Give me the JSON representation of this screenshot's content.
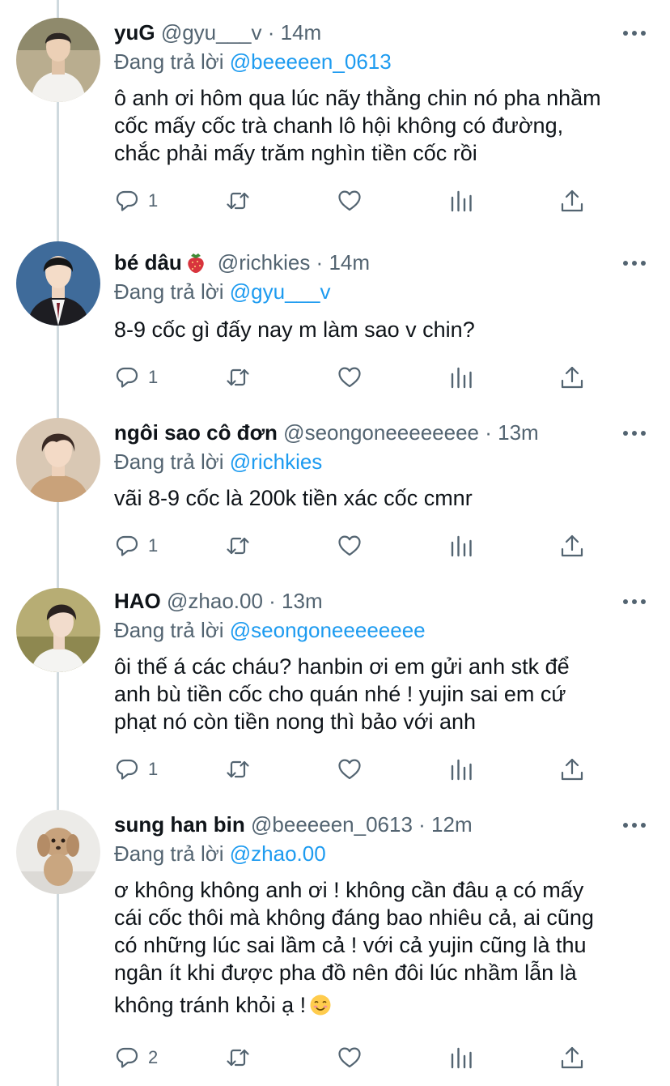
{
  "tweets": [
    {
      "name": "yuG",
      "handle": "@gyu___v",
      "time": "14m",
      "replying_prefix": "Đang trả lời ",
      "replying_to": "@beeeeen_0613",
      "text_lines": [
        "ô anh ơi hôm qua lúc nãy thằng chin nó pha nhầm",
        "cốc mấy cốc trà chanh lô hội không có đường,",
        "chắc phải mấy trăm nghìn tiền cốc rồi"
      ],
      "reply_count": "1"
    },
    {
      "name": "bé dâu",
      "name_emoji": "strawberry-emoji",
      "handle": "@richkies",
      "time": "14m",
      "replying_prefix": "Đang trả lời ",
      "replying_to": "@gyu___v",
      "text_lines": [
        "8-9 cốc gì đấy nay m làm sao v chin?"
      ],
      "reply_count": "1"
    },
    {
      "name": "ngôi sao cô đơn",
      "handle": "@seongoneeeeeeee",
      "time": "13m",
      "replying_prefix": "Đang trả lời ",
      "replying_to": "@richkies",
      "text_lines": [
        "vãi 8-9 cốc là 200k tiền xác cốc cmnr"
      ],
      "reply_count": "1"
    },
    {
      "name": "HAO",
      "handle": "@zhao.00",
      "time": "13m",
      "replying_prefix": "Đang trả lời ",
      "replying_to": "@seongoneeeeeeee",
      "text_lines": [
        "ôi thế á các cháu? hanbin ơi em gửi anh stk để",
        "anh bù tiền cốc cho quán nhé ! yujin sai em cứ",
        "phạt nó còn tiền nong thì bảo với anh"
      ],
      "reply_count": "1"
    },
    {
      "name": "sung han bin",
      "handle": "@beeeeen_0613",
      "time": "12m",
      "replying_prefix": "Đang trả lời ",
      "replying_to": "@zhao.00",
      "text_lines": [
        "ơ không không anh ơi ! không cần đâu ạ có mấy",
        "cái cốc thôi mà không đáng bao nhiêu cả, ai cũng",
        "có những lúc sai lầm cả ! với cả yujin cũng là thu",
        "ngân ít khi được pha đồ nên đôi lúc nhầm lẫn là",
        "không tránh khỏi ạ !"
      ],
      "trailing_emoji": "smiling-face-emoji",
      "reply_count": "2"
    }
  ],
  "separator": " · ",
  "icons": {
    "reply": "reply-icon",
    "retweet": "retweet-icon",
    "like": "heart-icon",
    "analytics": "analytics-icon",
    "share": "share-icon",
    "more": "more-icon"
  },
  "colors": {
    "text": "#0f1419",
    "secondary": "#536471",
    "link": "#1d9bf0",
    "thread_line": "#cfd9de"
  }
}
